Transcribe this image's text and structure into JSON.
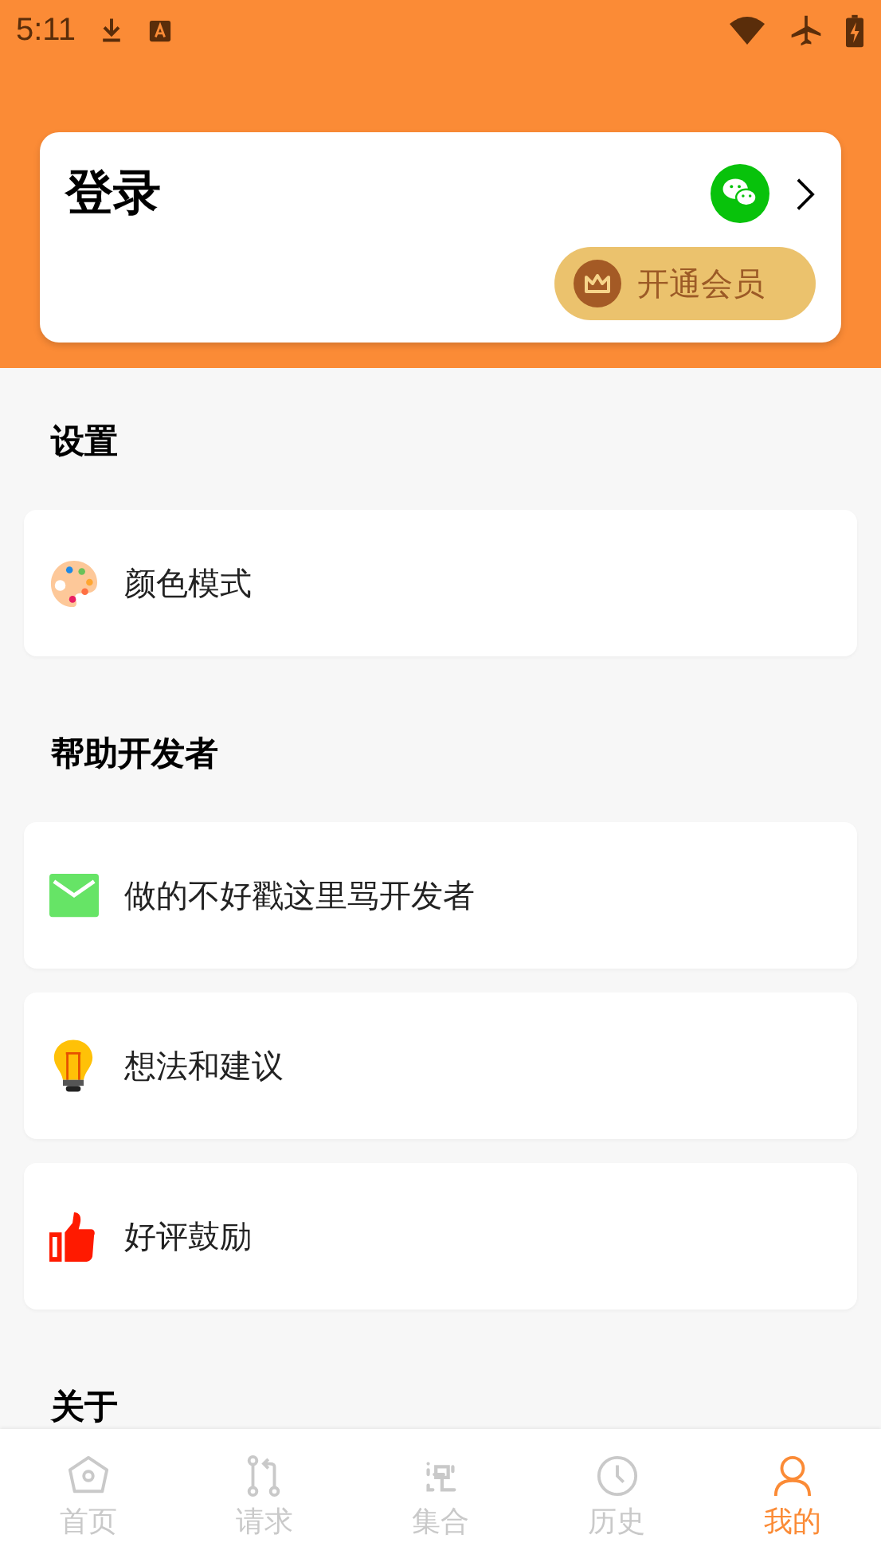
{
  "status_bar": {
    "time": "5:11"
  },
  "login_card": {
    "title": "登录",
    "member_button": "开通会员"
  },
  "sections": [
    {
      "heading": "设置",
      "items": [
        {
          "kind": "palette",
          "label": "颜色模式"
        }
      ]
    },
    {
      "heading": "帮助开发者",
      "items": [
        {
          "kind": "mail",
          "label": "做的不好戳这里骂开发者"
        },
        {
          "kind": "bulb",
          "label": "想法和建议"
        },
        {
          "kind": "thumb",
          "label": "好评鼓励"
        }
      ]
    },
    {
      "heading": "关于"
    }
  ],
  "tabs": [
    {
      "kind": "home",
      "label": "首页",
      "selected": false
    },
    {
      "kind": "request",
      "label": "请求",
      "selected": false
    },
    {
      "kind": "collection",
      "label": "集合",
      "selected": false
    },
    {
      "kind": "history",
      "label": "历史",
      "selected": false
    },
    {
      "kind": "profile",
      "label": "我的",
      "selected": true
    }
  ]
}
